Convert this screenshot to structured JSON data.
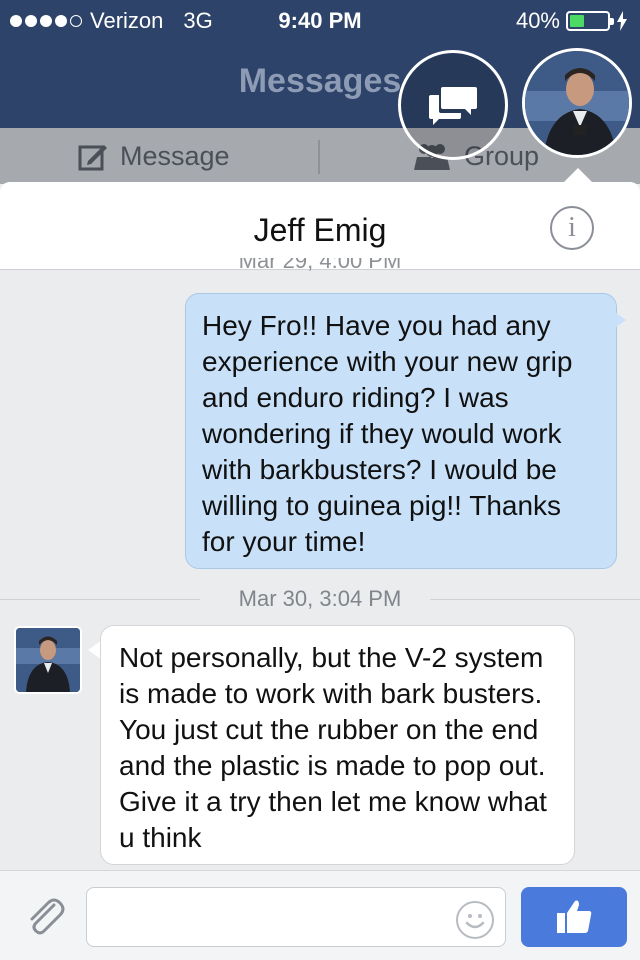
{
  "status_bar": {
    "carrier": "Verizon",
    "network": "3G",
    "time": "9:40 PM",
    "battery": "40%",
    "battery_level": 0.4
  },
  "nav": {
    "title": "Messages"
  },
  "segments": {
    "message_label": "Message",
    "group_label": "Group"
  },
  "conversation": {
    "contact_name": "Jeff Emig",
    "prev_timestamp_partial": "Mar 29, 4:00 PM",
    "messages": [
      {
        "direction": "outgoing",
        "text": "Hey Fro!! Have you had any experience with your new grip and enduro riding? I was wondering if they would work with barkbusters? I would be willing to guinea pig!! Thanks for your time!"
      },
      {
        "timestamp": "Mar 30, 3:04 PM"
      },
      {
        "direction": "incoming",
        "text": "Not personally, but the V-2 system is made to work with bark busters. You just cut the rubber on the end and the plastic is made to pop out. Give it a try then let me know what u think"
      }
    ]
  },
  "composer": {
    "value": "",
    "placeholder": ""
  },
  "colors": {
    "nav_bg": "#2d4369",
    "outgoing_bubble": "#c8e1f8",
    "like_button": "#4a7bdc",
    "battery_green": "#4cd964"
  },
  "icons": {
    "attach": "paperclip-icon",
    "emoji": "smiley-icon",
    "like": "thumbs-up-icon",
    "info": "info-icon",
    "compose": "compose-icon",
    "group": "group-icon",
    "chat_heads": "chat-bubbles-icon"
  }
}
